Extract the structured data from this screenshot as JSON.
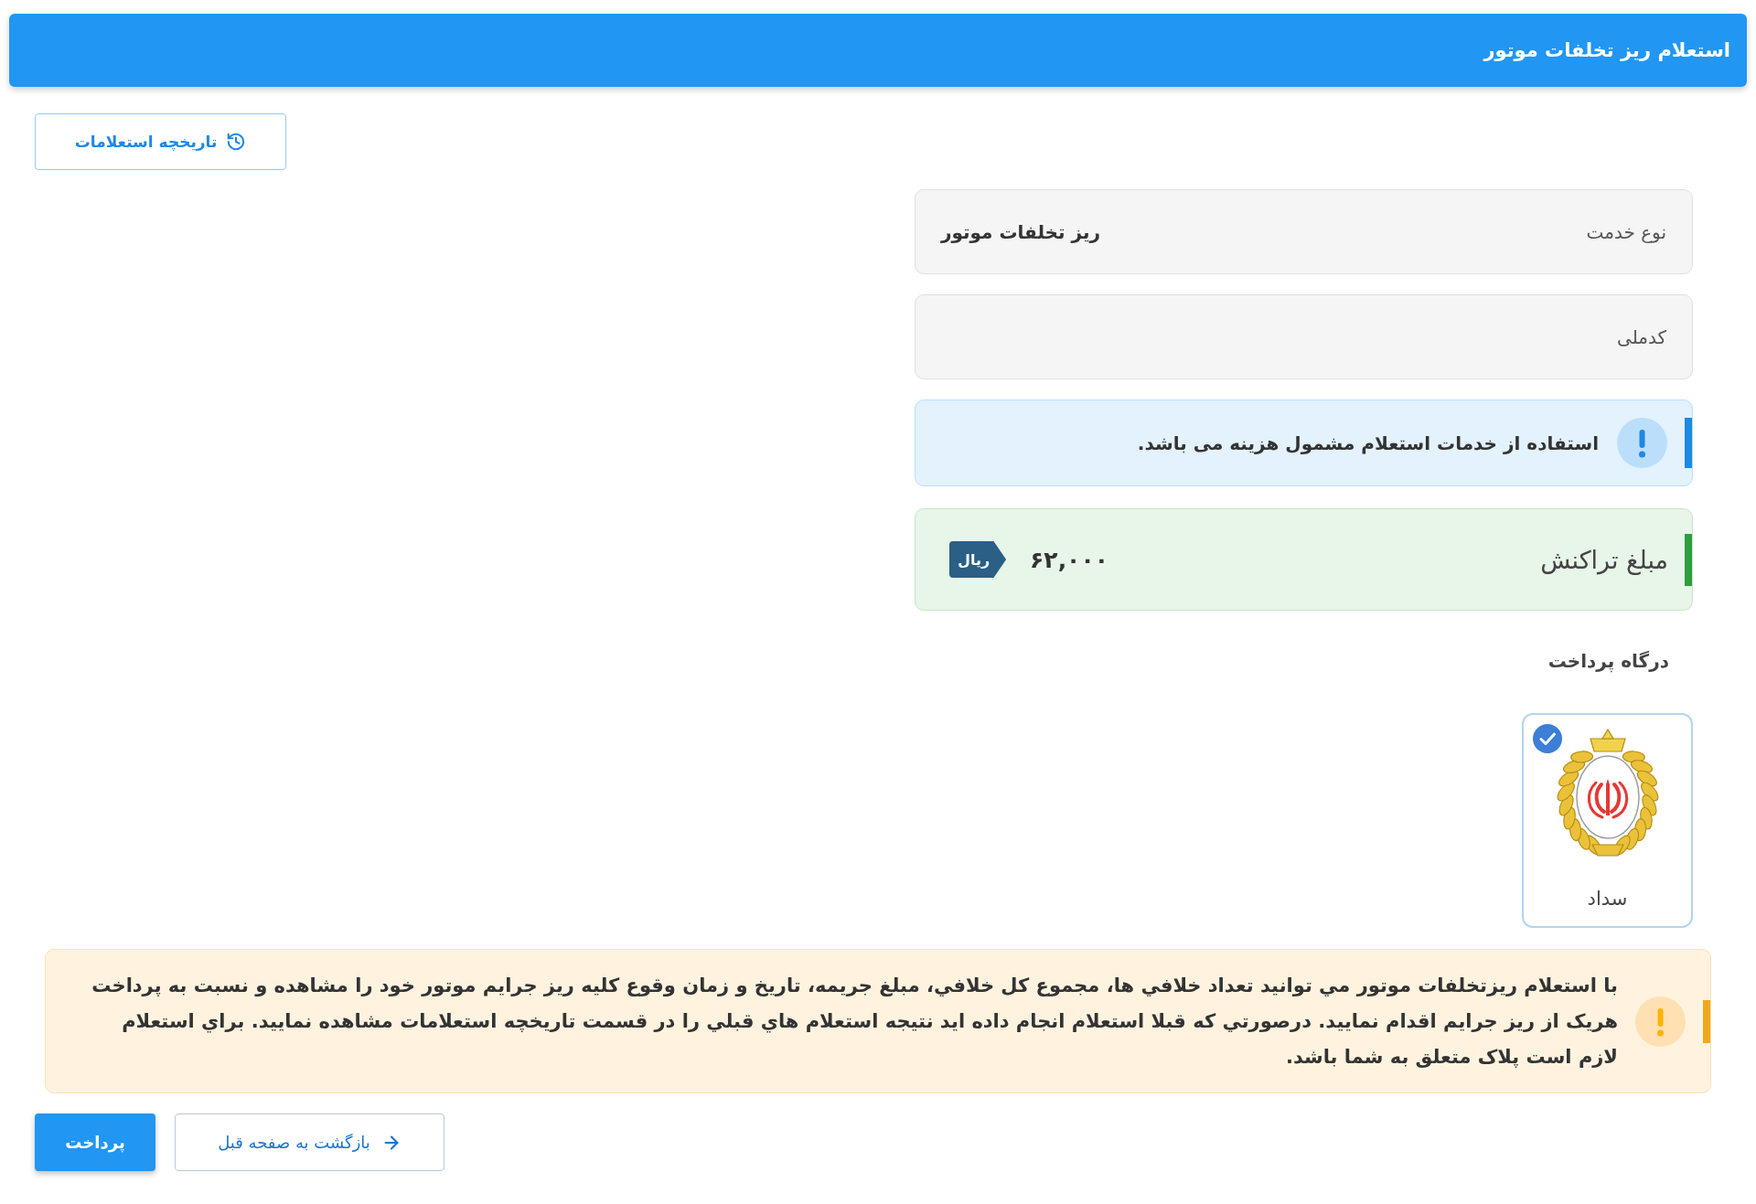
{
  "header": {
    "title": "استعلام ریز تخلفات موتور"
  },
  "history_button": {
    "label": "تاریخچه استعلامات"
  },
  "fields": [
    {
      "label": "نوع خدمت",
      "value": "ریز تخلفات موتور"
    },
    {
      "label": "کدملی"
    }
  ],
  "info_alert": {
    "text": "استفاده از خدمات استعلام مشمول هزینه می باشد."
  },
  "amount": {
    "label": "مبلغ تراکنش",
    "value": "۶۲,۰۰۰",
    "currency": "ریال"
  },
  "gateway_section": {
    "title": "درگاه پرداخت",
    "gateways": [
      {
        "name": "سداد",
        "selected": true
      }
    ]
  },
  "notice": {
    "text": "با استعلام ریزتخلفات موتور مي توانيد تعداد خلافي ها، مجموع کل خلافي، مبلغ جريمه، تاريخ و زمان وقوع کليه ريز جرايم موتور خود را مشاهده و نسبت به پرداخت هريک از ريز جرايم اقدام نماييد. درصورتي که قبلا استعلام انجام داده ايد نتيجه استعلام هاي قبلي را در قسمت تاريخچه استعلامات مشاهده نماييد. براي استعلام لازم است پلاک متعلق به شما باشد."
  },
  "buttons": [
    {
      "label": "بازگشت به صفحه قبل",
      "kind": "back"
    },
    {
      "label": "پرداخت",
      "kind": "primary"
    }
  ]
}
